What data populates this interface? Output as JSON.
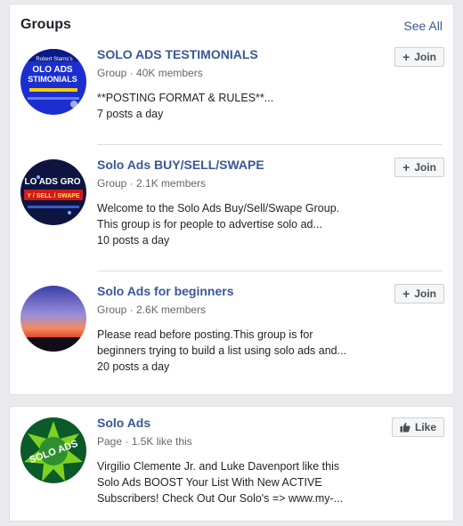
{
  "groups": {
    "header": "Groups",
    "see_all": "See All",
    "items": [
      {
        "title": "SOLO ADS TESTIMONIALS",
        "meta": "Group · 40K members",
        "desc1": "**POSTING FORMAT & RULES**...",
        "desc2": "7 posts a day",
        "desc3": "",
        "button": "Join",
        "avatar_text1": "Robert Starns's",
        "avatar_text2": "OLO ADS",
        "avatar_text3": "STIMONIALS"
      },
      {
        "title": "Solo Ads BUY/SELL/SWAPE",
        "meta": "Group · 2.1K members",
        "desc1": "Welcome to the Solo Ads Buy/Sell/Swape Group.",
        "desc2": "This group is for people to advertise solo ad...",
        "desc3": "10 posts a day",
        "button": "Join",
        "avatar_text1": "LO ADS GRO",
        "avatar_text2": "Y / SELL / SWAPE"
      },
      {
        "title": "Solo Ads for beginners",
        "meta": "Group · 2.6K members",
        "desc1": "Please read before posting.This group is for",
        "desc2": "beginners trying to build a list using solo ads and...",
        "desc3": "20 posts a day",
        "button": "Join"
      }
    ]
  },
  "page": {
    "title": "Solo Ads",
    "meta": "Page · 1.5K like this",
    "desc1": "Virgilio Clemente Jr. and Luke Davenport like this",
    "desc2": "Solo Ads BOOST Your List With New ACTIVE",
    "desc3": "Subscribers! Check Out Our Solo's => www.my-...",
    "button": "Like",
    "avatar_text": "SOLO ADS"
  },
  "colors": {
    "link": "#385898",
    "background": "#e9ebee"
  }
}
